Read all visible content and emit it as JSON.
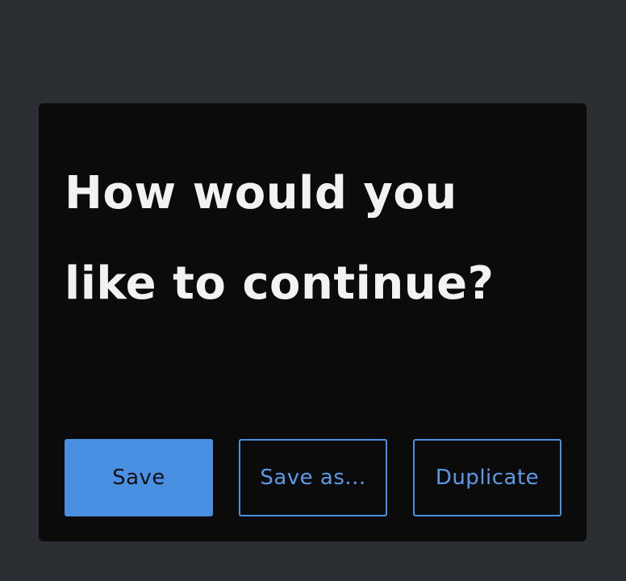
{
  "dialog": {
    "title_line_1": "How would you",
    "title_line_2": "like to continue?",
    "buttons": {
      "save": "Save",
      "save_as": "Save as...",
      "duplicate": "Duplicate"
    }
  },
  "colors": {
    "page_background": "#2b2e33",
    "dialog_background": "#0b0b0c",
    "accent": "#4a90e2",
    "title_text": "#f2f2f2"
  }
}
